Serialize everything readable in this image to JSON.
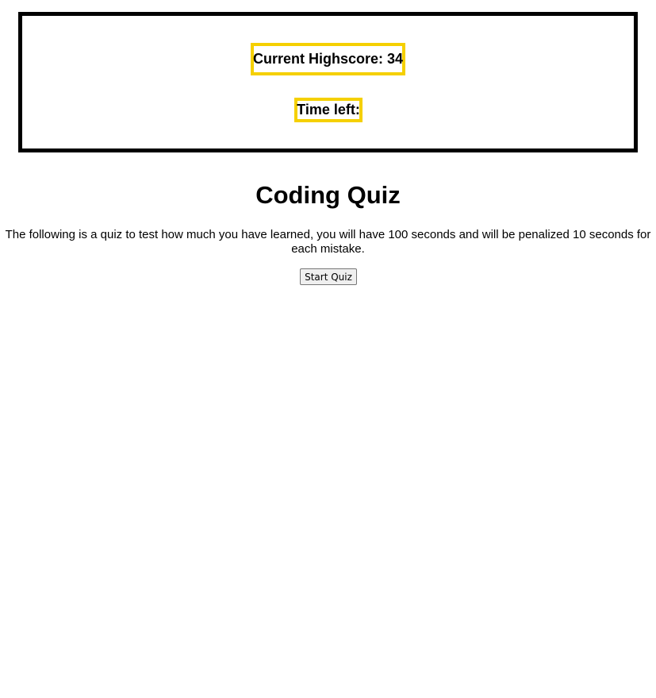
{
  "header": {
    "highscore_text": "Current Highscore: 34",
    "timer_text": "Time left:"
  },
  "main": {
    "title": "Coding Quiz",
    "description": "The following is a quiz to test how much you have learned, you will have 100 seconds and will be penalized 10 seconds for each mistake.",
    "start_button_label": "Start Quiz"
  },
  "colors": {
    "highlight_border": "#f5d000",
    "header_border": "#000000"
  }
}
